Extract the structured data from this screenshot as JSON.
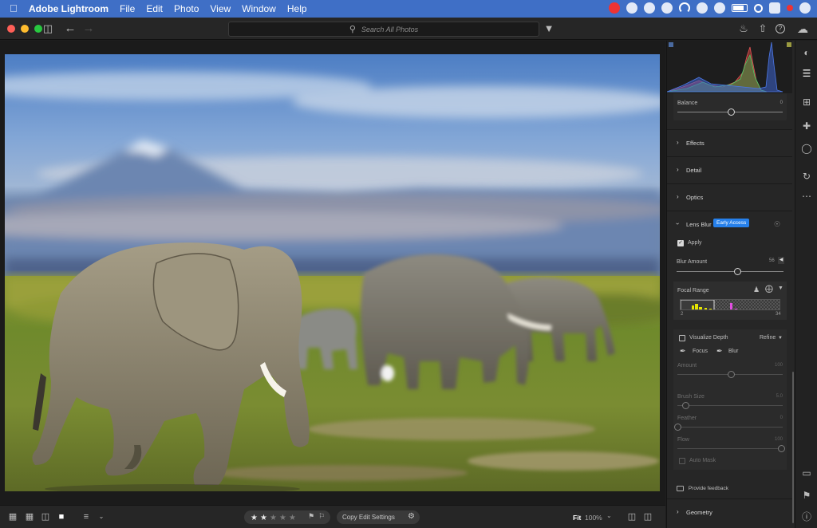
{
  "menubar": {
    "app_name": "Adobe Lightroom",
    "items": [
      "File",
      "Edit",
      "Photo",
      "View",
      "Window",
      "Help"
    ]
  },
  "toolbar": {
    "search_placeholder": "Search All Photos"
  },
  "panel": {
    "balance": {
      "label": "Balance",
      "value": "0",
      "level": 0.5
    },
    "sections": {
      "effects": "Effects",
      "detail": "Detail",
      "optics": "Optics",
      "lens_blur": "Lens Blur",
      "geometry": "Geometry"
    },
    "early_access": "Early Access",
    "apply_label": "Apply",
    "blur_amount": {
      "label": "Blur Amount",
      "value": "56",
      "level": 0.56
    },
    "focal_range": {
      "label": "Focal Range",
      "min": "2",
      "max": "34"
    },
    "visualize_depth": "Visualize Depth",
    "refine": "Refine",
    "focus": "Focus",
    "blur": "Blur",
    "amount": {
      "label": "Amount",
      "value": "100",
      "level": 0.5
    },
    "brush_size": {
      "label": "Brush Size",
      "value": "5.0",
      "level": 0.05
    },
    "feather": {
      "label": "Feather",
      "value": "0",
      "level": 0.0
    },
    "flow": {
      "label": "Flow",
      "value": "100",
      "level": 1.0
    },
    "auto_mask": "Auto Mask",
    "feedback": "Provide feedback"
  },
  "bottombar": {
    "rating": 2,
    "max_rating": 5,
    "copy_edit": "Copy Edit Settings",
    "fit": "Fit",
    "zoom": "100%"
  },
  "colors": {
    "menubar": "#3f6fc6",
    "accent": "#2680eb",
    "panel_bg": "#262626"
  }
}
